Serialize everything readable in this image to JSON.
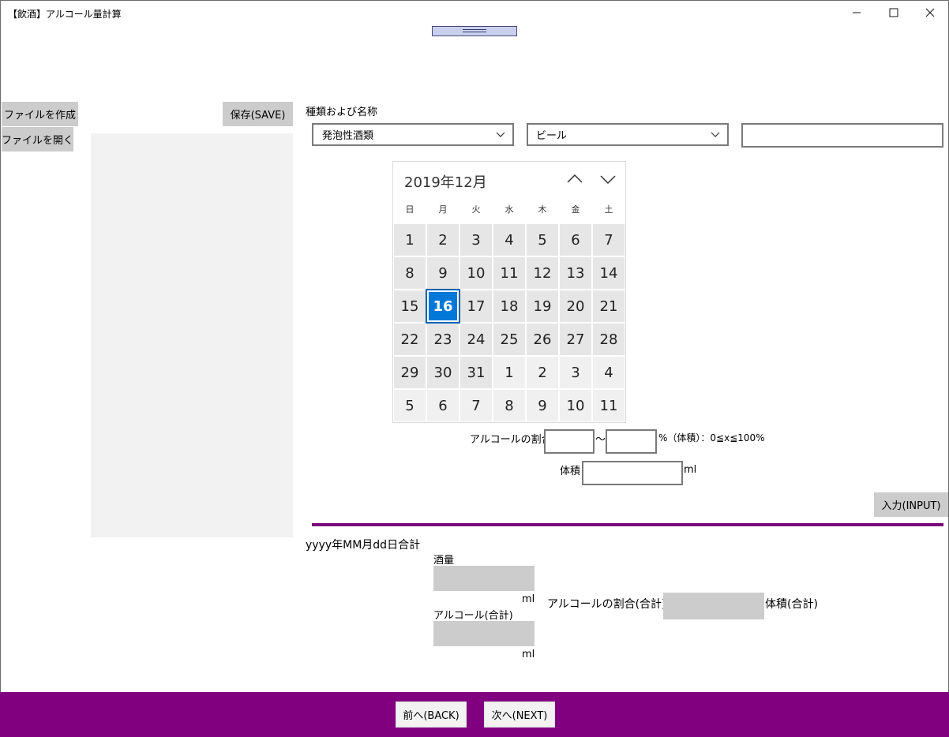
{
  "window": {
    "title": "【飲酒】アルコール量計算",
    "minimize": "─",
    "maximize": "☐",
    "close": "✕"
  },
  "sidebar": {
    "create_file": "ファイルを作成",
    "open_file": "ファイルを開く"
  },
  "save_button": "保存(SAVE)",
  "form": {
    "category_label": "種類および名称",
    "category_value": "発泡性酒類",
    "subtype_value": "ビール",
    "name_value": ""
  },
  "calendar": {
    "header": "2019年12月",
    "weekdays": [
      "日",
      "月",
      "火",
      "水",
      "木",
      "金",
      "土"
    ],
    "days": [
      "1",
      "2",
      "3",
      "4",
      "5",
      "6",
      "7",
      "8",
      "9",
      "10",
      "11",
      "12",
      "13",
      "14",
      "15",
      "16",
      "17",
      "18",
      "19",
      "20",
      "21",
      "22",
      "23",
      "24",
      "25",
      "26",
      "27",
      "28",
      "29",
      "30",
      "31",
      "1",
      "2",
      "3",
      "4",
      "5",
      "6",
      "7",
      "8",
      "9",
      "10",
      "11"
    ],
    "selected_index": 15,
    "current_month_count": 31
  },
  "alcohol": {
    "ratio_label": "アルコールの割合",
    "range_sep": "〜",
    "ratio_suffix": "%（体積）：0≦x≦100%",
    "volume_label": "体積",
    "volume_unit": "ml"
  },
  "input_button": "入力(INPUT)",
  "summary": {
    "title": "yyyy年MM月dd日合計",
    "amount_label": "酒量",
    "amount_unit": "ml",
    "alcohol_total_label": "アルコール(合計)",
    "alcohol_total_unit": "ml",
    "ratio_total_label": "アルコールの割合(合計)",
    "volume_total_label": "体積(合計)"
  },
  "nav": {
    "back": "前へ(BACK)",
    "next": "次へ(NEXT)"
  },
  "colors": {
    "accent_purple": "#800080",
    "selected_day": "#0078d7",
    "button_gray": "#cccccc"
  }
}
